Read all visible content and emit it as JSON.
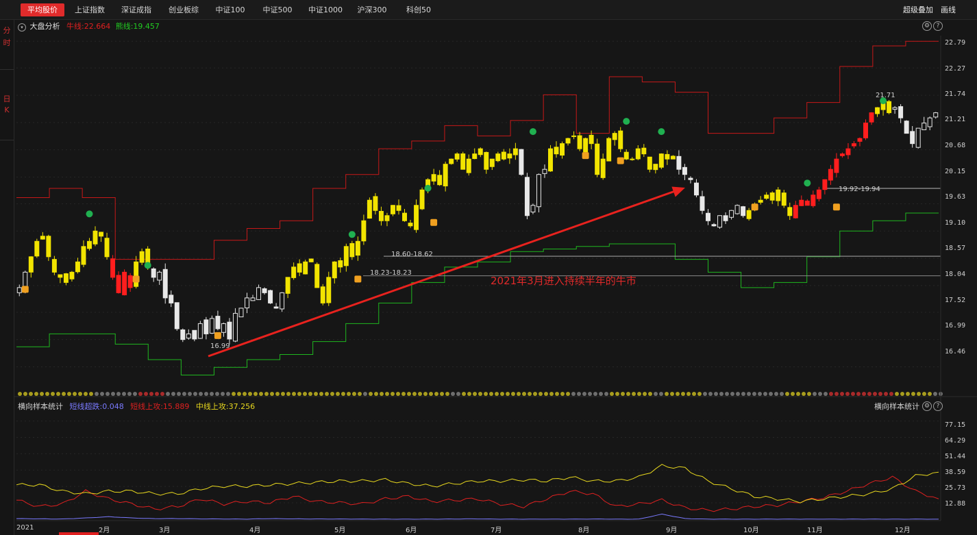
{
  "tabs": [
    {
      "label": "平均股价",
      "active": true
    },
    {
      "label": "上证指数",
      "active": false
    },
    {
      "label": "深证成指",
      "active": false
    },
    {
      "label": "创业板综",
      "active": false
    },
    {
      "label": "中证100",
      "active": false
    },
    {
      "label": "中证500",
      "active": false
    },
    {
      "label": "中证1000",
      "active": false
    },
    {
      "label": "沪深300",
      "active": false
    },
    {
      "label": "科创50",
      "active": false
    }
  ],
  "top_right": {
    "overlay": "超级叠加",
    "draw": "画线"
  },
  "left_tabs": {
    "intraday": [
      "分",
      "时"
    ],
    "daily": [
      "日",
      "K"
    ]
  },
  "info": {
    "analysis": "大盘分析",
    "bull_line": "牛线:22.664",
    "bear_line": "熊线:19.457"
  },
  "indicator": {
    "title": "横向样本统计",
    "short_oversold": "短线超跌:0.048",
    "short_attack": "短线上攻:15.889",
    "mid_attack": "中线上攻:37.256",
    "right_title": "横向样本统计",
    "help_icon": "?",
    "settings_icon": "gear-icon"
  },
  "annotation": "2021年3月进入持续半年的牛市",
  "chart_data": [
    {
      "type": "candlestick",
      "y_ticks": [
        "22.79",
        "22.27",
        "21.74",
        "21.21",
        "20.68",
        "20.15",
        "19.63",
        "19.10",
        "18.57",
        "18.04",
        "17.52",
        "16.99",
        "16.46"
      ],
      "ylim": [
        16.0,
        22.9
      ],
      "x_labels": [
        "2021",
        "2月",
        "3月",
        "4月",
        "5月",
        "6月",
        "7月",
        "8月",
        "9月",
        "10月",
        "11月",
        "12月"
      ],
      "labels": {
        "low": "16.99",
        "high": "21.71",
        "zone1": "18.60-18.62",
        "zone2": "18.23-18.23",
        "zone3": "19.92-19.94"
      },
      "zones": [
        18.61,
        18.23,
        19.93
      ],
      "bull_line_start": 19.75,
      "bear_line_start": 16.85,
      "close": [
        18.0,
        18.3,
        18.6,
        18.9,
        19.0,
        18.6,
        18.3,
        18.2,
        18.1,
        18.3,
        18.5,
        18.8,
        18.9,
        19.1,
        19.0,
        18.6,
        18.2,
        17.9,
        18.3,
        18.0,
        18.5,
        18.7,
        18.4,
        18.2,
        18.3,
        17.8,
        17.7,
        17.2,
        16.99,
        17.1,
        17.0,
        17.3,
        17.1,
        17.4,
        17.2,
        17.3,
        17.0,
        17.5,
        17.6,
        17.8,
        17.8,
        18.0,
        17.9,
        17.7,
        17.6,
        17.9,
        18.2,
        18.4,
        18.3,
        18.5,
        18.5,
        18.0,
        17.7,
        18.2,
        18.5,
        18.4,
        18.8,
        18.6,
        18.9,
        19.3,
        19.7,
        19.5,
        19.3,
        19.4,
        19.6,
        19.5,
        19.3,
        19.2,
        19.6,
        19.9,
        20.1,
        20.2,
        20.0,
        20.4,
        20.5,
        20.6,
        20.3,
        20.5,
        20.6,
        20.7,
        20.3,
        20.5,
        20.6,
        20.5,
        20.6,
        20.7,
        20.2,
        19.4,
        19.6,
        20.2,
        20.3,
        20.7,
        20.6,
        20.8,
        20.9,
        20.95,
        20.7,
        20.9,
        20.8,
        20.2,
        20.5,
        20.9,
        21.0,
        20.7,
        20.5,
        20.5,
        20.7,
        20.6,
        20.3,
        20.4,
        20.6,
        20.5,
        20.5,
        20.3,
        20.2,
        20.1,
        19.8,
        19.5,
        19.3,
        19.2,
        19.4,
        19.3,
        19.5,
        19.6,
        19.4,
        19.5,
        19.6,
        19.7,
        19.8,
        19.7,
        19.9,
        19.6,
        19.4,
        19.6,
        19.7,
        19.6,
        19.8,
        19.9,
        20.1,
        20.3,
        20.5,
        20.6,
        20.7,
        20.8,
        20.9,
        21.2,
        21.4,
        21.5,
        21.6,
        21.4,
        21.5,
        21.3,
        21.0,
        20.8,
        21.1,
        21.2,
        21.3,
        21.4
      ],
      "bull_steps": [
        19.75,
        19.93,
        19.75,
        18.55,
        18.55,
        18.55,
        18.92,
        19.15,
        19.3,
        19.93,
        20.2,
        20.7,
        20.85,
        21.15,
        20.95,
        21.25,
        21.75,
        21.0,
        22.1,
        22.0,
        21.8,
        21.0,
        21.0,
        21.3,
        21.6,
        22.3,
        22.7,
        22.79
      ],
      "bear_steps": [
        16.85,
        17.1,
        17.1,
        16.9,
        16.6,
        16.3,
        16.45,
        16.6,
        16.7,
        16.95,
        17.3,
        17.7,
        18.1,
        18.4,
        18.5,
        18.7,
        18.75,
        18.8,
        18.85,
        18.85,
        18.55,
        18.3,
        18.0,
        18.1,
        18.6,
        19.1,
        19.3,
        19.45
      ]
    },
    {
      "type": "line",
      "title": "横向样本统计",
      "y_ticks": [
        "77.15",
        "64.29",
        "51.44",
        "38.59",
        "25.73",
        "12.88"
      ],
      "ylim": [
        0,
        85
      ],
      "series": [
        {
          "name": "短线超跌",
          "color": "#7a7aff",
          "values": [
            0.5,
            0.3,
            0.2,
            1.0,
            2.0,
            1.0,
            0.5,
            0.5,
            0.3,
            0.2,
            0.1,
            0.5,
            0.3,
            0.2,
            0.2,
            0.1,
            0.1,
            0.1,
            0.1,
            0.2,
            0.3,
            0.1,
            0.1,
            0.1,
            0.1,
            0.2,
            0.1,
            0.1,
            4.0,
            0.5,
            0.1,
            0.1,
            0.1,
            0.1,
            0.1,
            0.1,
            0.1,
            0.1,
            0.1,
            0.1,
            0.05
          ]
        },
        {
          "name": "短线上攻",
          "color": "#e02020",
          "values": [
            15,
            10,
            12,
            22,
            16,
            12,
            8,
            10,
            16,
            12,
            14,
            13,
            18,
            14,
            13,
            12,
            16,
            18,
            14,
            15,
            16,
            12,
            10,
            16,
            22,
            20,
            10,
            12,
            15,
            9,
            7,
            8,
            10,
            11,
            14,
            17,
            22,
            28,
            33,
            22,
            16
          ]
        },
        {
          "name": "中线上攻",
          "color": "#e8d81e",
          "values": [
            27,
            27,
            22,
            20,
            22,
            22,
            20,
            20,
            24,
            26,
            26,
            27,
            28,
            29,
            30,
            30,
            31,
            28,
            26,
            28,
            30,
            30,
            31,
            30,
            33,
            30,
            30,
            33,
            42,
            40,
            30,
            24,
            18,
            16,
            14,
            16,
            18,
            20,
            24,
            34,
            37
          ]
        }
      ]
    }
  ]
}
